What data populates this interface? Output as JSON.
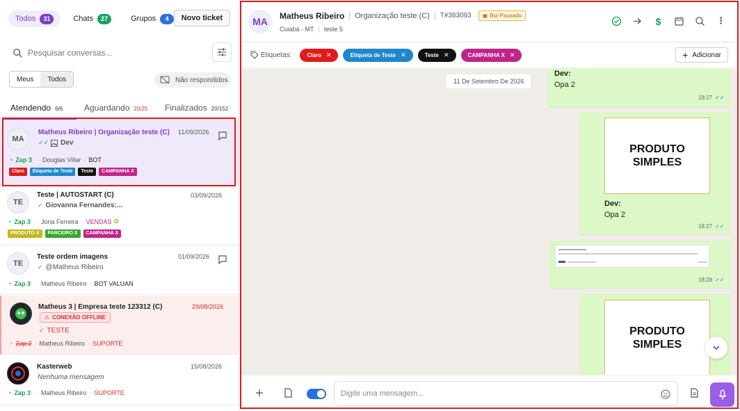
{
  "sidebar": {
    "tabs": [
      {
        "label": "Todos",
        "count": "31",
        "color": "#7b3fc4"
      },
      {
        "label": "Chats",
        "count": "27",
        "color": "#1aa35f"
      },
      {
        "label": "Grupos",
        "count": "4",
        "color": "#2b6fde"
      }
    ],
    "novo_ticket": "Novo ticket",
    "search_placeholder": "Pesquisar conversas...",
    "seg": [
      "Meus",
      "Todos"
    ],
    "nao_respondidos": "Não respondidos",
    "status_tabs": [
      {
        "label": "Atendendo",
        "count": "6/6"
      },
      {
        "label": "Aguardando",
        "count": "20/25"
      },
      {
        "label": "Finalizados",
        "count": "20/152"
      }
    ],
    "tickets": [
      {
        "initials": "MA",
        "name": "Matheus Ribeiro | Organização teste (C)",
        "date": "11/09/2026",
        "msg": "Dev",
        "conn": "Zap 3",
        "user": "Douglas Villar",
        "queue": "BOT",
        "tags": [
          {
            "t": "Claro",
            "c": "#e01b1b"
          },
          {
            "t": "Etiqueta de Teste",
            "c": "#1f87c9"
          },
          {
            "t": "Teste",
            "c": "#111111"
          },
          {
            "t": "CAMPANHA X",
            "c": "#c0248a"
          }
        ]
      },
      {
        "initials": "TE",
        "name": "Teste | AUTOSTART (C)",
        "date": "03/09/2026",
        "msg": "Giovanna Fernandes:...",
        "conn": "Zap 3",
        "user": "Jona Ferreira",
        "queue": "VENDAS",
        "tags": [
          {
            "t": "PRODUTO X",
            "c": "#c2b81a"
          },
          {
            "t": "PARCEIRO X",
            "c": "#3aa62f"
          },
          {
            "t": "CAMPANHA X",
            "c": "#c0248a"
          }
        ]
      },
      {
        "initials": "TE",
        "name": "Teste ordem imagens",
        "date": "01/09/2026",
        "msg": "@Matheus Ribeiro",
        "conn": "Zap 3",
        "user": "Matheus Ribeiro",
        "queue": "BOT VALUAN",
        "tags": []
      },
      {
        "initials": "",
        "name": "Matheus 3 | Empresa teste 123312 (C)",
        "date": "29/08/2026",
        "offline": "CONEXÃO OFFLINE",
        "msg": "TESTE",
        "conn": "Zap 2",
        "user": "Matheus Ribeiro",
        "queue": "SUPORTE",
        "tags": []
      },
      {
        "initials": "",
        "name": "Kasterweb",
        "date": "15/08/2026",
        "msg": "Nenhuma mensagem",
        "conn": "Zap 3",
        "user": "Matheus Ribeiro",
        "queue": "SUPORTE",
        "tags": []
      }
    ]
  },
  "chat": {
    "initials": "MA",
    "name": "Matheus Ribeiro",
    "org": "Organização teste (C)",
    "ticket_id": "T#383093",
    "bot_status": "Bot Pausado",
    "city": "Cuiabá - MT",
    "queue": "teste 5",
    "tags_label": "Etiquetas:",
    "tags": [
      {
        "t": "Claro",
        "c": "#e01b1b"
      },
      {
        "t": "Etiqueta de Teste",
        "c": "#1f87c9"
      },
      {
        "t": "Teste",
        "c": "#111111"
      },
      {
        "t": "CAMPANHA X",
        "c": "#c0248a"
      }
    ],
    "add_label": "Adicionar",
    "date_divider": "11 De Setembro De 2026",
    "messages": [
      {
        "who": "Dev:",
        "text": "Opa 2",
        "time": "18:27"
      },
      {
        "image_text": "PRODUTO SIMPLES",
        "who": "Dev:",
        "text": "Opa 2",
        "time": "18:27"
      },
      {
        "doc": true,
        "time": "18:28"
      },
      {
        "image_text": "PRODUTO SIMPLES"
      }
    ],
    "input_placeholder": "Digite uma mensagem..."
  },
  "colors": {
    "accent": "#7b3fc4",
    "bubble": "#dcf8c6",
    "frame": "#d91c1c"
  }
}
